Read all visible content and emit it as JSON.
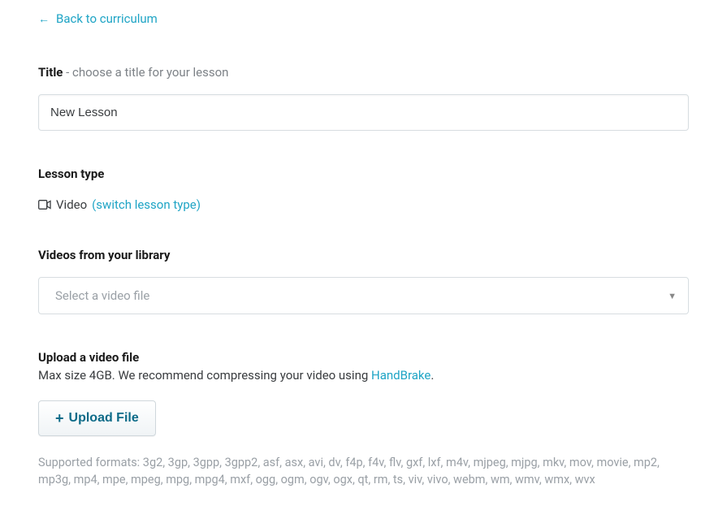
{
  "back_link": {
    "label": "Back to curriculum"
  },
  "title_section": {
    "label": "Title",
    "sublabel": " - choose a title for your lesson",
    "input_value": "New Lesson"
  },
  "lesson_type_section": {
    "label": "Lesson type",
    "type_text": "Video",
    "switch_link": "(switch lesson type)"
  },
  "library_section": {
    "label": "Videos from your library",
    "select_placeholder": "Select a video file"
  },
  "upload_section": {
    "label": "Upload a video file",
    "hint_prefix": "Max size 4GB. We recommend compressing your video using ",
    "handbrake": "HandBrake",
    "hint_suffix": ".",
    "button_label": "Upload File",
    "supported_formats": "Supported formats: 3g2, 3gp, 3gpp, 3gpp2, asf, asx, avi, dv, f4p, f4v, flv, gxf, lxf, m4v, mjpeg, mjpg, mkv, mov, movie, mp2, mp3g, mp4, mpe, mpeg, mpg, mpg4, mxf, ogg, ogm, ogv, ogx, qt, rm, ts, viv, vivo, webm, wm, wmv, wmx, wvx"
  }
}
